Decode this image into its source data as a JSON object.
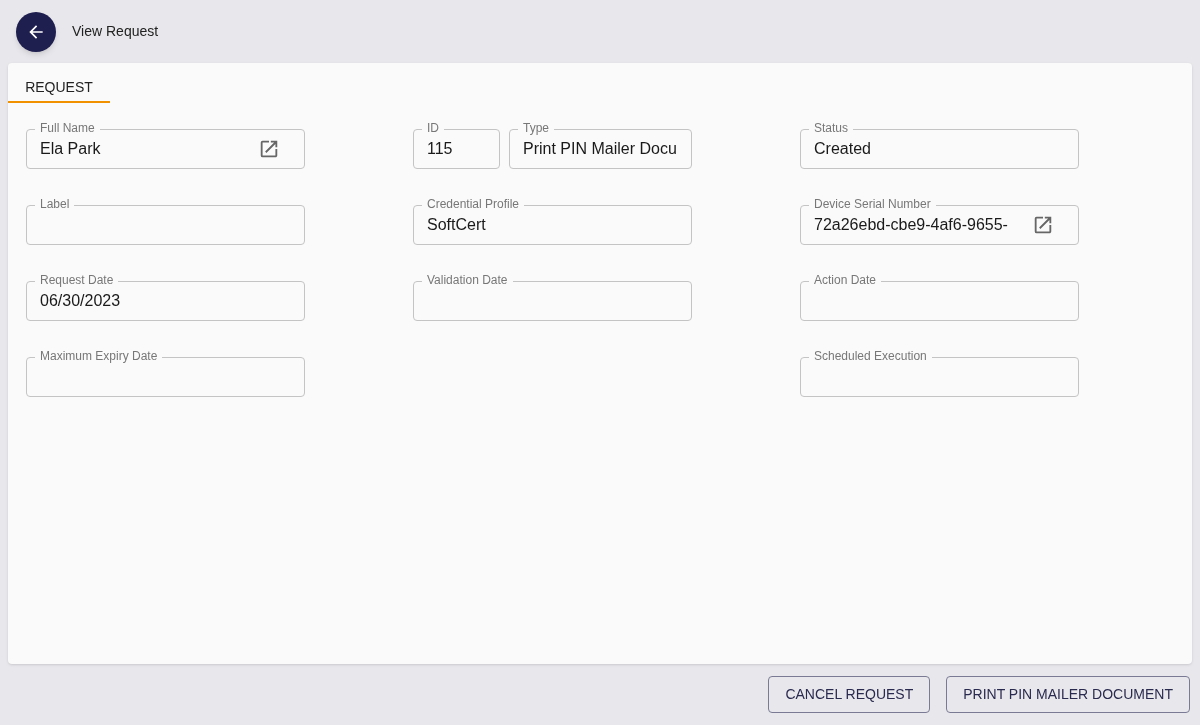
{
  "header": {
    "title": "View Request"
  },
  "tabs": [
    {
      "label": "REQUEST",
      "selected": true
    }
  ],
  "columns": [
    {
      "rows": [
        [
          {
            "label": "Full Name",
            "value": "Ela Park",
            "link": true
          }
        ],
        [
          {
            "label": "Label",
            "link": false
          }
        ],
        [
          {
            "label": "Request Date",
            "value": "06/30/2023",
            "link": false
          }
        ],
        [
          {
            "label": "Maximum Expiry Date",
            "link": false
          }
        ]
      ]
    },
    {
      "rows": [
        [
          {
            "label": "ID",
            "value": "115",
            "link": false
          },
          {
            "label": "Type",
            "value": "Print PIN Mailer Docu",
            "link": false
          }
        ],
        [
          {
            "label": "Credential Profile",
            "value": "SoftCert",
            "link": false
          }
        ],
        [
          {
            "label": "Validation Date",
            "link": false
          }
        ]
      ]
    },
    {
      "rows": [
        [
          {
            "label": "Status",
            "value": "Created",
            "link": false
          }
        ],
        [
          {
            "label": "Device Serial Number",
            "value": "72a26ebd-cbe9-4af6-9655-",
            "link": true
          }
        ],
        [
          {
            "label": "Action Date",
            "link": false
          }
        ],
        [
          {
            "label": "Scheduled Execution",
            "link": false
          }
        ]
      ]
    }
  ],
  "buttons": [
    "CANCEL REQUEST",
    "PRINT PIN MAILER DOCUMENT"
  ]
}
